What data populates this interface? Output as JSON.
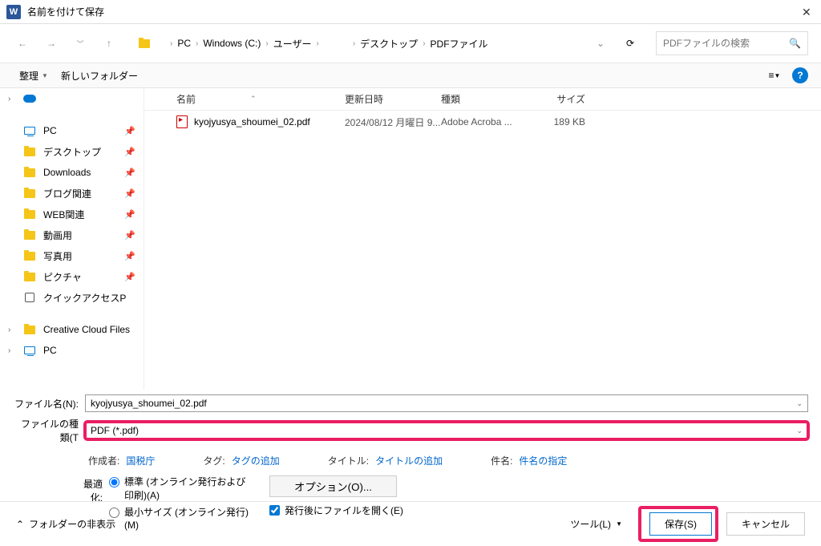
{
  "window": {
    "title": "名前を付けて保存"
  },
  "breadcrumb": {
    "items": [
      "PC",
      "Windows (C:)",
      "ユーザー",
      "",
      "デスクトップ",
      "PDFファイル"
    ]
  },
  "search": {
    "placeholder": "PDFファイルの検索"
  },
  "toolbar": {
    "organize": "整理",
    "new_folder": "新しいフォルダー"
  },
  "sidebar": {
    "top_item": "",
    "items": [
      {
        "label": "PC",
        "type": "pc"
      },
      {
        "label": "デスクトップ",
        "type": "folder"
      },
      {
        "label": "Downloads",
        "type": "folder"
      },
      {
        "label": "ブログ関連",
        "type": "folder"
      },
      {
        "label": "WEB関連",
        "type": "folder"
      },
      {
        "label": "動画用",
        "type": "folder"
      },
      {
        "label": "写真用",
        "type": "folder"
      },
      {
        "label": "ピクチャ",
        "type": "folder"
      },
      {
        "label": "クイックアクセスP",
        "type": "quick"
      }
    ],
    "bottom": [
      {
        "label": "Creative Cloud Files",
        "type": "folder"
      },
      {
        "label": "PC",
        "type": "pc"
      }
    ]
  },
  "filelist": {
    "headers": {
      "name": "名前",
      "date": "更新日時",
      "type": "種類",
      "size": "サイズ"
    },
    "rows": [
      {
        "name": "kyojyusya_shoumei_02.pdf",
        "date": "2024/08/12 月曜日 9...",
        "type": "Adobe Acroba ...",
        "size": "189 KB"
      }
    ]
  },
  "form": {
    "filename_label": "ファイル名(N):",
    "filename_value": "kyojyusya_shoumei_02.pdf",
    "filetype_label": "ファイルの種類(T",
    "filetype_value": "PDF (*.pdf)"
  },
  "meta": {
    "author_label": "作成者:",
    "author_value": "国税庁",
    "tag_label": "タグ:",
    "tag_value": "タグの追加",
    "title_label": "タイトル:",
    "title_value": "タイトルの追加",
    "subject_label": "件名:",
    "subject_value": "件名の指定"
  },
  "optimize": {
    "label": "最適化:",
    "standard": "標準 (オンライン発行および印刷)(A)",
    "minimum": "最小サイズ (オンライン発行)(M)",
    "options_btn": "オプション(O)...",
    "open_after": "発行後にファイルを開く(E)"
  },
  "footer": {
    "hide_folders": "フォルダーの非表示",
    "tools": "ツール(L)",
    "save": "保存(S)",
    "cancel": "キャンセル"
  }
}
